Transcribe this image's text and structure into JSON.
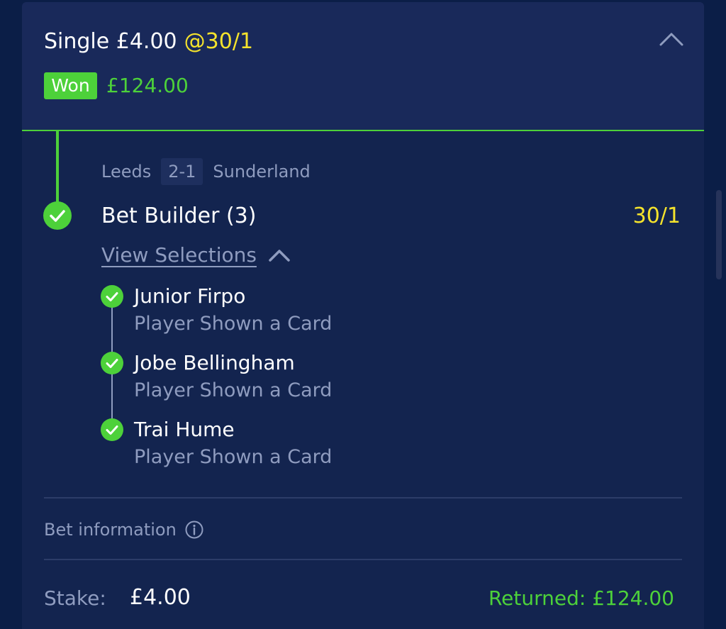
{
  "bet": {
    "title": "Single £4.00",
    "odds": "@30/1",
    "status": "Won",
    "won_amount": "£124.00"
  },
  "leg": {
    "home_team": "Leeds",
    "score": "2-1",
    "away_team": "Sunderland",
    "market": "Bet Builder (3)",
    "odds": "30/1",
    "view_selections_label": "View Selections"
  },
  "selections": [
    {
      "name": "Junior Firpo",
      "market": "Player Shown a Card"
    },
    {
      "name": "Jobe Bellingham",
      "market": "Player Shown a Card"
    },
    {
      "name": "Trai Hume",
      "market": "Player Shown a Card"
    }
  ],
  "footer": {
    "bet_information_label": "Bet information",
    "stake_label": "Stake:",
    "stake_value": "£4.00",
    "returned": "Returned: £124.00"
  },
  "icons": {
    "collapse": "chevron-up-icon",
    "check": "check-icon",
    "info": "info-icon"
  },
  "colors": {
    "background": "#0b1e47",
    "card": "#13244f",
    "header": "#19295a",
    "success": "#4dd13a",
    "odds": "#f5e32c",
    "muted": "#8f9cbf"
  }
}
